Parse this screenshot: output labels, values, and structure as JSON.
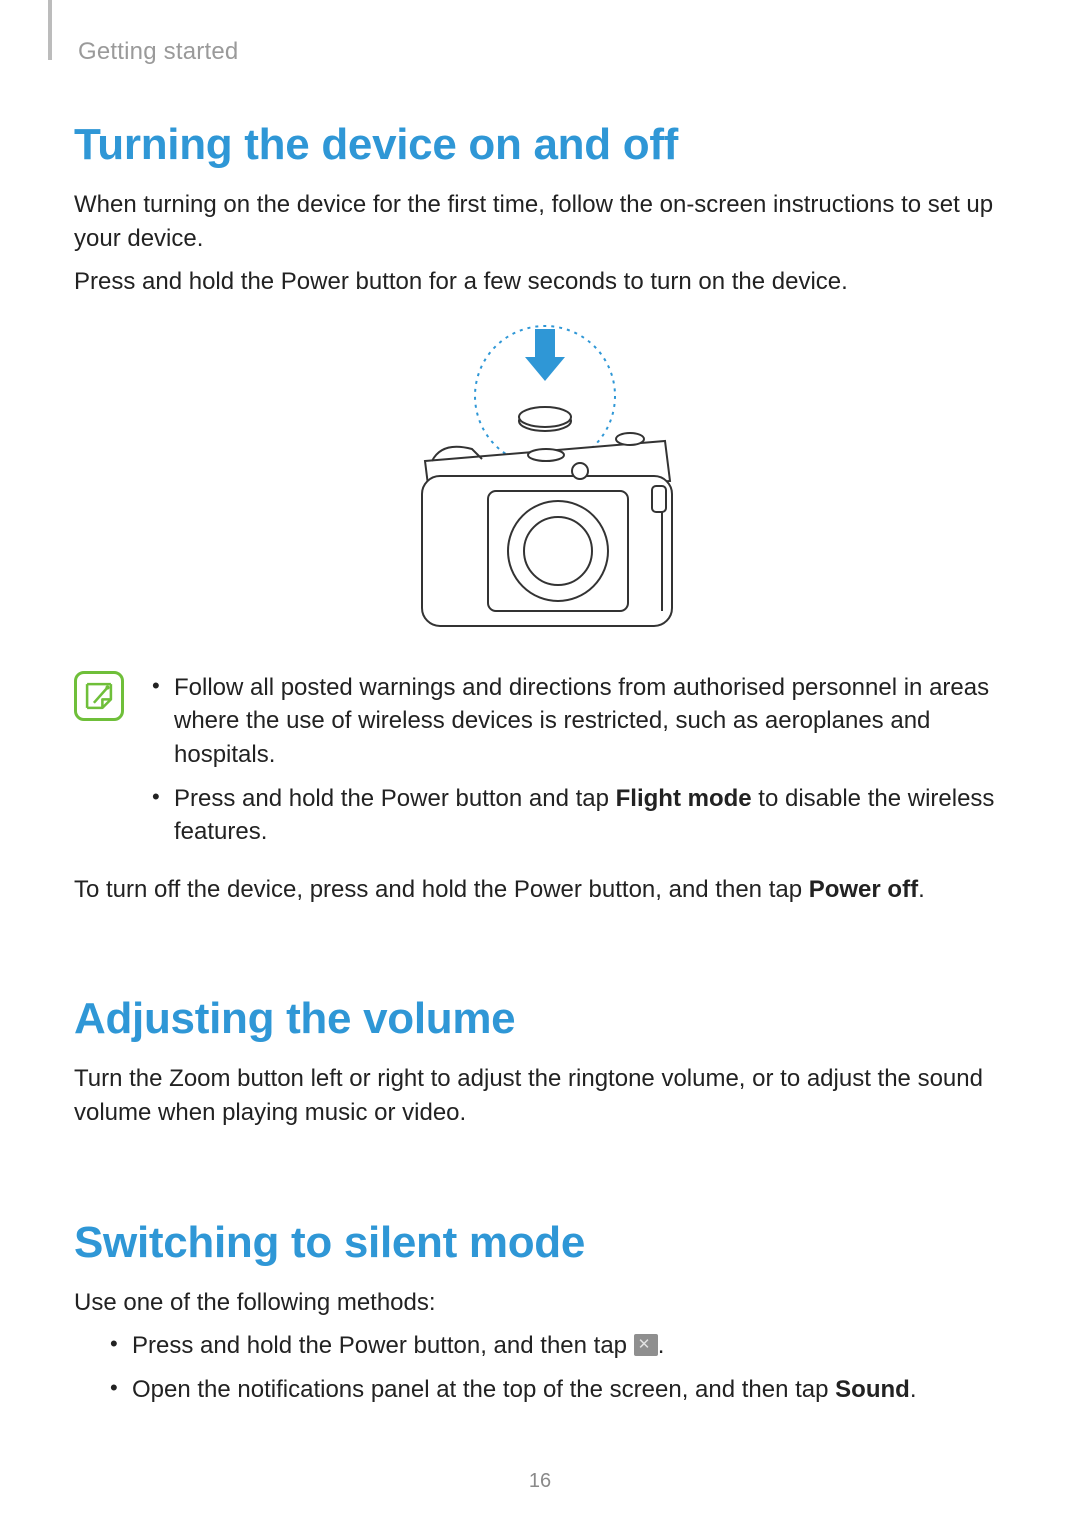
{
  "breadcrumb": "Getting started",
  "page_number": "16",
  "sections": {
    "power": {
      "title": "Turning the device on and off",
      "p1": "When turning on the device for the first time, follow the on-screen instructions to set up your device.",
      "p2": "Press and hold the Power button for a few seconds to turn on the device.",
      "note_items": [
        {
          "text": "Follow all posted warnings and directions from authorised personnel in areas where the use of wireless devices is restricted, such as aeroplanes and hospitals."
        },
        {
          "pre": "Press and hold the Power button and tap ",
          "bold": "Flight mode",
          "post": " to disable the wireless features."
        }
      ],
      "p3_pre": "To turn off the device, press and hold the Power button, and then tap ",
      "p3_bold": "Power off",
      "p3_post": "."
    },
    "volume": {
      "title": "Adjusting the volume",
      "p1": "Turn the Zoom button left or right to adjust the ringtone volume, or to adjust the sound volume when playing music or video."
    },
    "silent": {
      "title": "Switching to silent mode",
      "p1": "Use one of the following methods:",
      "items": [
        {
          "pre": "Press and hold the Power button, and then tap ",
          "icon": "mute-icon",
          "post": "."
        },
        {
          "pre": "Open the notifications panel at the top of the screen, and then tap ",
          "bold": "Sound",
          "post": "."
        }
      ]
    }
  }
}
